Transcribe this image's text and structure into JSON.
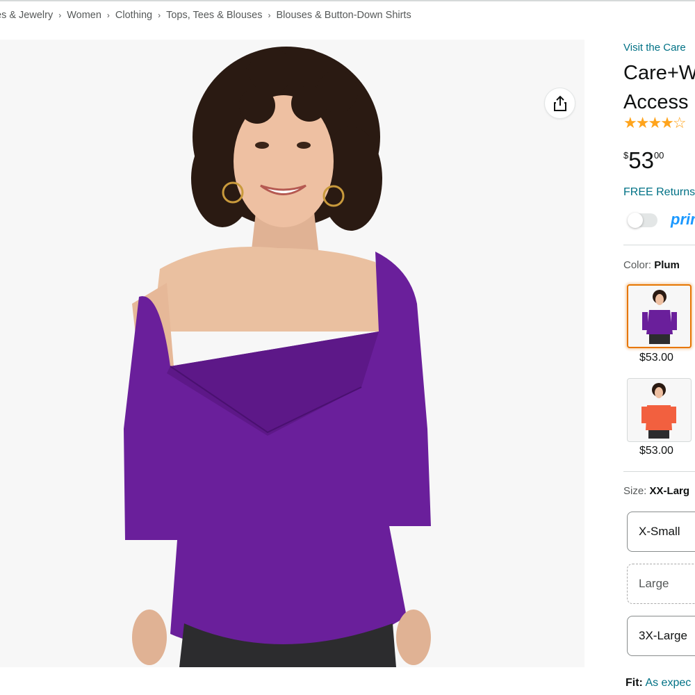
{
  "breadcrumb": {
    "items": [
      "es & Jewelry",
      "Women",
      "Clothing",
      "Tops, Tees & Blouses",
      "Blouses & Button-Down Shirts"
    ],
    "separator": "›"
  },
  "product": {
    "store_link": "Visit the Care",
    "title_line1": "Care+W",
    "title_line2": "Access C",
    "rating_stars": "★★★★☆",
    "price_symbol": "$",
    "price_whole": "53",
    "price_fraction": "00",
    "returns_text": "FREE Returns",
    "prime_label": "prim"
  },
  "color": {
    "label": "Color:",
    "selected": "Plum",
    "swatches": [
      {
        "name": "plum",
        "price": "$53.00",
        "hex": "#6a1f9b",
        "selected": true
      },
      {
        "name": "coral",
        "price": "$53.00",
        "hex": "#f2603f",
        "selected": false
      }
    ]
  },
  "size": {
    "label": "Size:",
    "selected": "XX-Larg",
    "options": [
      {
        "label": "X-Small",
        "available": true
      },
      {
        "label": "Large",
        "available": false
      },
      {
        "label": "3X-Large",
        "available": true
      }
    ]
  },
  "fit": {
    "label": "Fit:",
    "value": "As expec"
  },
  "icons": {
    "share": "share-icon"
  },
  "colors": {
    "link": "#007185",
    "star": "#ffa41c",
    "prime": "#1a98ff",
    "selected_border": "#e77600",
    "shirt": "#6a1f9b"
  }
}
